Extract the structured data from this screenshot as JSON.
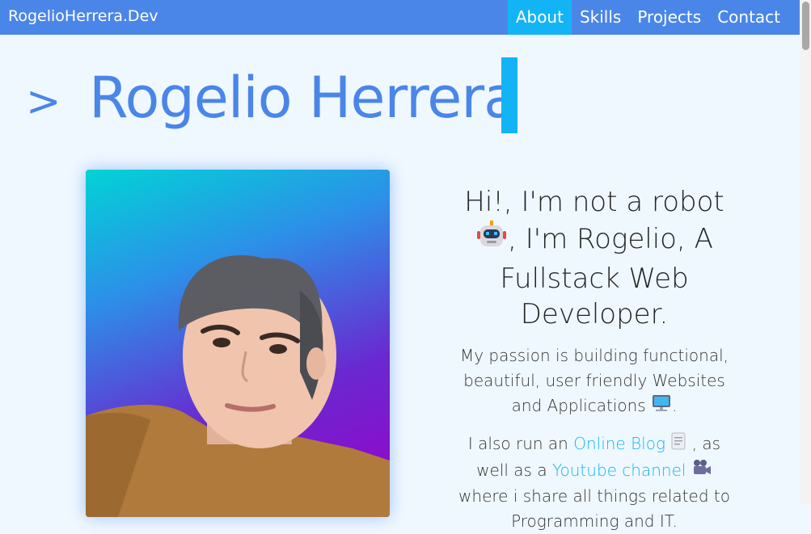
{
  "navbar": {
    "brand": "RogelioHerrera.Dev",
    "links": [
      {
        "label": "About",
        "active": true
      },
      {
        "label": "Skills",
        "active": false
      },
      {
        "label": "Projects",
        "active": false
      },
      {
        "label": "Contact",
        "active": false
      }
    ]
  },
  "hero": {
    "prompt": ">",
    "name": "Rogelio Herrera"
  },
  "intro": {
    "headline_part1": "Hi!, I'm not a robot",
    "headline_part2": ", I'm Rogelio, A Fullstack Web Developer.",
    "passion_text": "My passion is building functional, beautiful, user friendly Websites and Applications",
    "passion_end": ".",
    "blog_prefix": "I also run an ",
    "blog_link": "Online Blog",
    "blog_mid": " , as well as a ",
    "youtube_link": "Youtube channel",
    "youtube_suffix": " where i share all things related to Programming and IT."
  },
  "colors": {
    "accent": "#4a86e8",
    "active_tab": "#13b4f6",
    "background": "#f0f8ff"
  },
  "icons": [
    "robot-icon",
    "computer-icon",
    "notepad-icon",
    "movie-camera-icon"
  ]
}
